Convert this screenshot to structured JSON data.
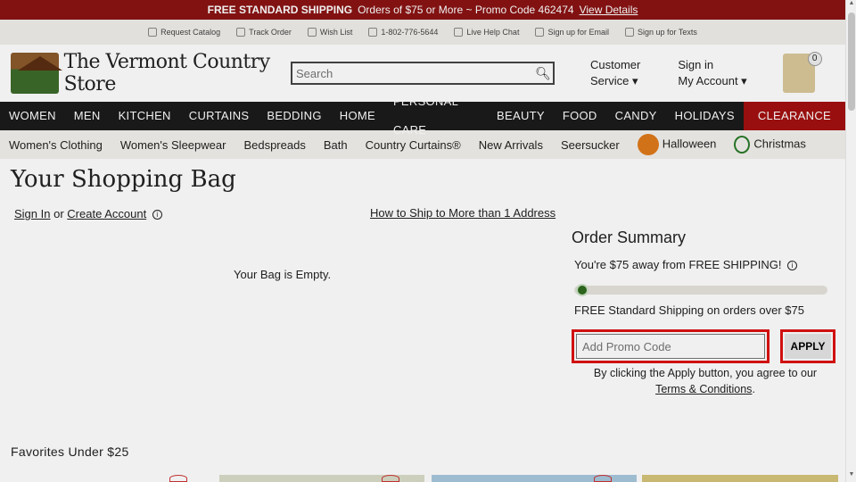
{
  "promo": {
    "title": "FREE STANDARD SHIPPING",
    "text": "Orders of $75 or More ~ Promo Code 462474",
    "link": "View Details"
  },
  "util": [
    "Request Catalog",
    "Track Order",
    "Wish List",
    "1-802-776-5644",
    "Live Help Chat",
    "Sign up for Email",
    "Sign up for Texts"
  ],
  "header": {
    "logo": "The Vermont Country Store",
    "search_placeholder": "Search",
    "customer_service_1": "Customer",
    "customer_service_2": "Service ▾",
    "signin_1": "Sign in",
    "signin_2": "My Account ▾",
    "bag_count": "0"
  },
  "nav": [
    "WOMEN",
    "MEN",
    "KITCHEN",
    "CURTAINS",
    "BEDDING",
    "HOME",
    "PERSONAL CARE",
    "BEAUTY",
    "FOOD",
    "CANDY",
    "HOLIDAYS"
  ],
  "nav_clearance": "CLEARANCE",
  "subnav": [
    "Women's Clothing",
    "Women's Sleepwear",
    "Bedspreads",
    "Bath",
    "Country Curtains®",
    "New Arrivals",
    "Seersucker"
  ],
  "subnav_halloween": "Halloween",
  "subnav_christmas": "Christmas",
  "main": {
    "title": "Your Shopping Bag",
    "sign_in": "Sign In",
    "or": "or",
    "create_account": "Create Account",
    "ship_link": "How to Ship to More than 1 Address",
    "empty": "Your Bag is Empty."
  },
  "summary": {
    "title": "Order Summary",
    "away": "You're $75 away from FREE SHIPPING!",
    "free": "FREE Standard Shipping on orders over $75",
    "shipping_progress": 0,
    "promo_placeholder": "Add Promo Code",
    "apply": "APPLY",
    "terms_text": "By clicking the Apply button, you agree to our",
    "terms_link": "Terms & Conditions",
    "terms_end": "."
  },
  "favorites": "Favorites Under $25"
}
